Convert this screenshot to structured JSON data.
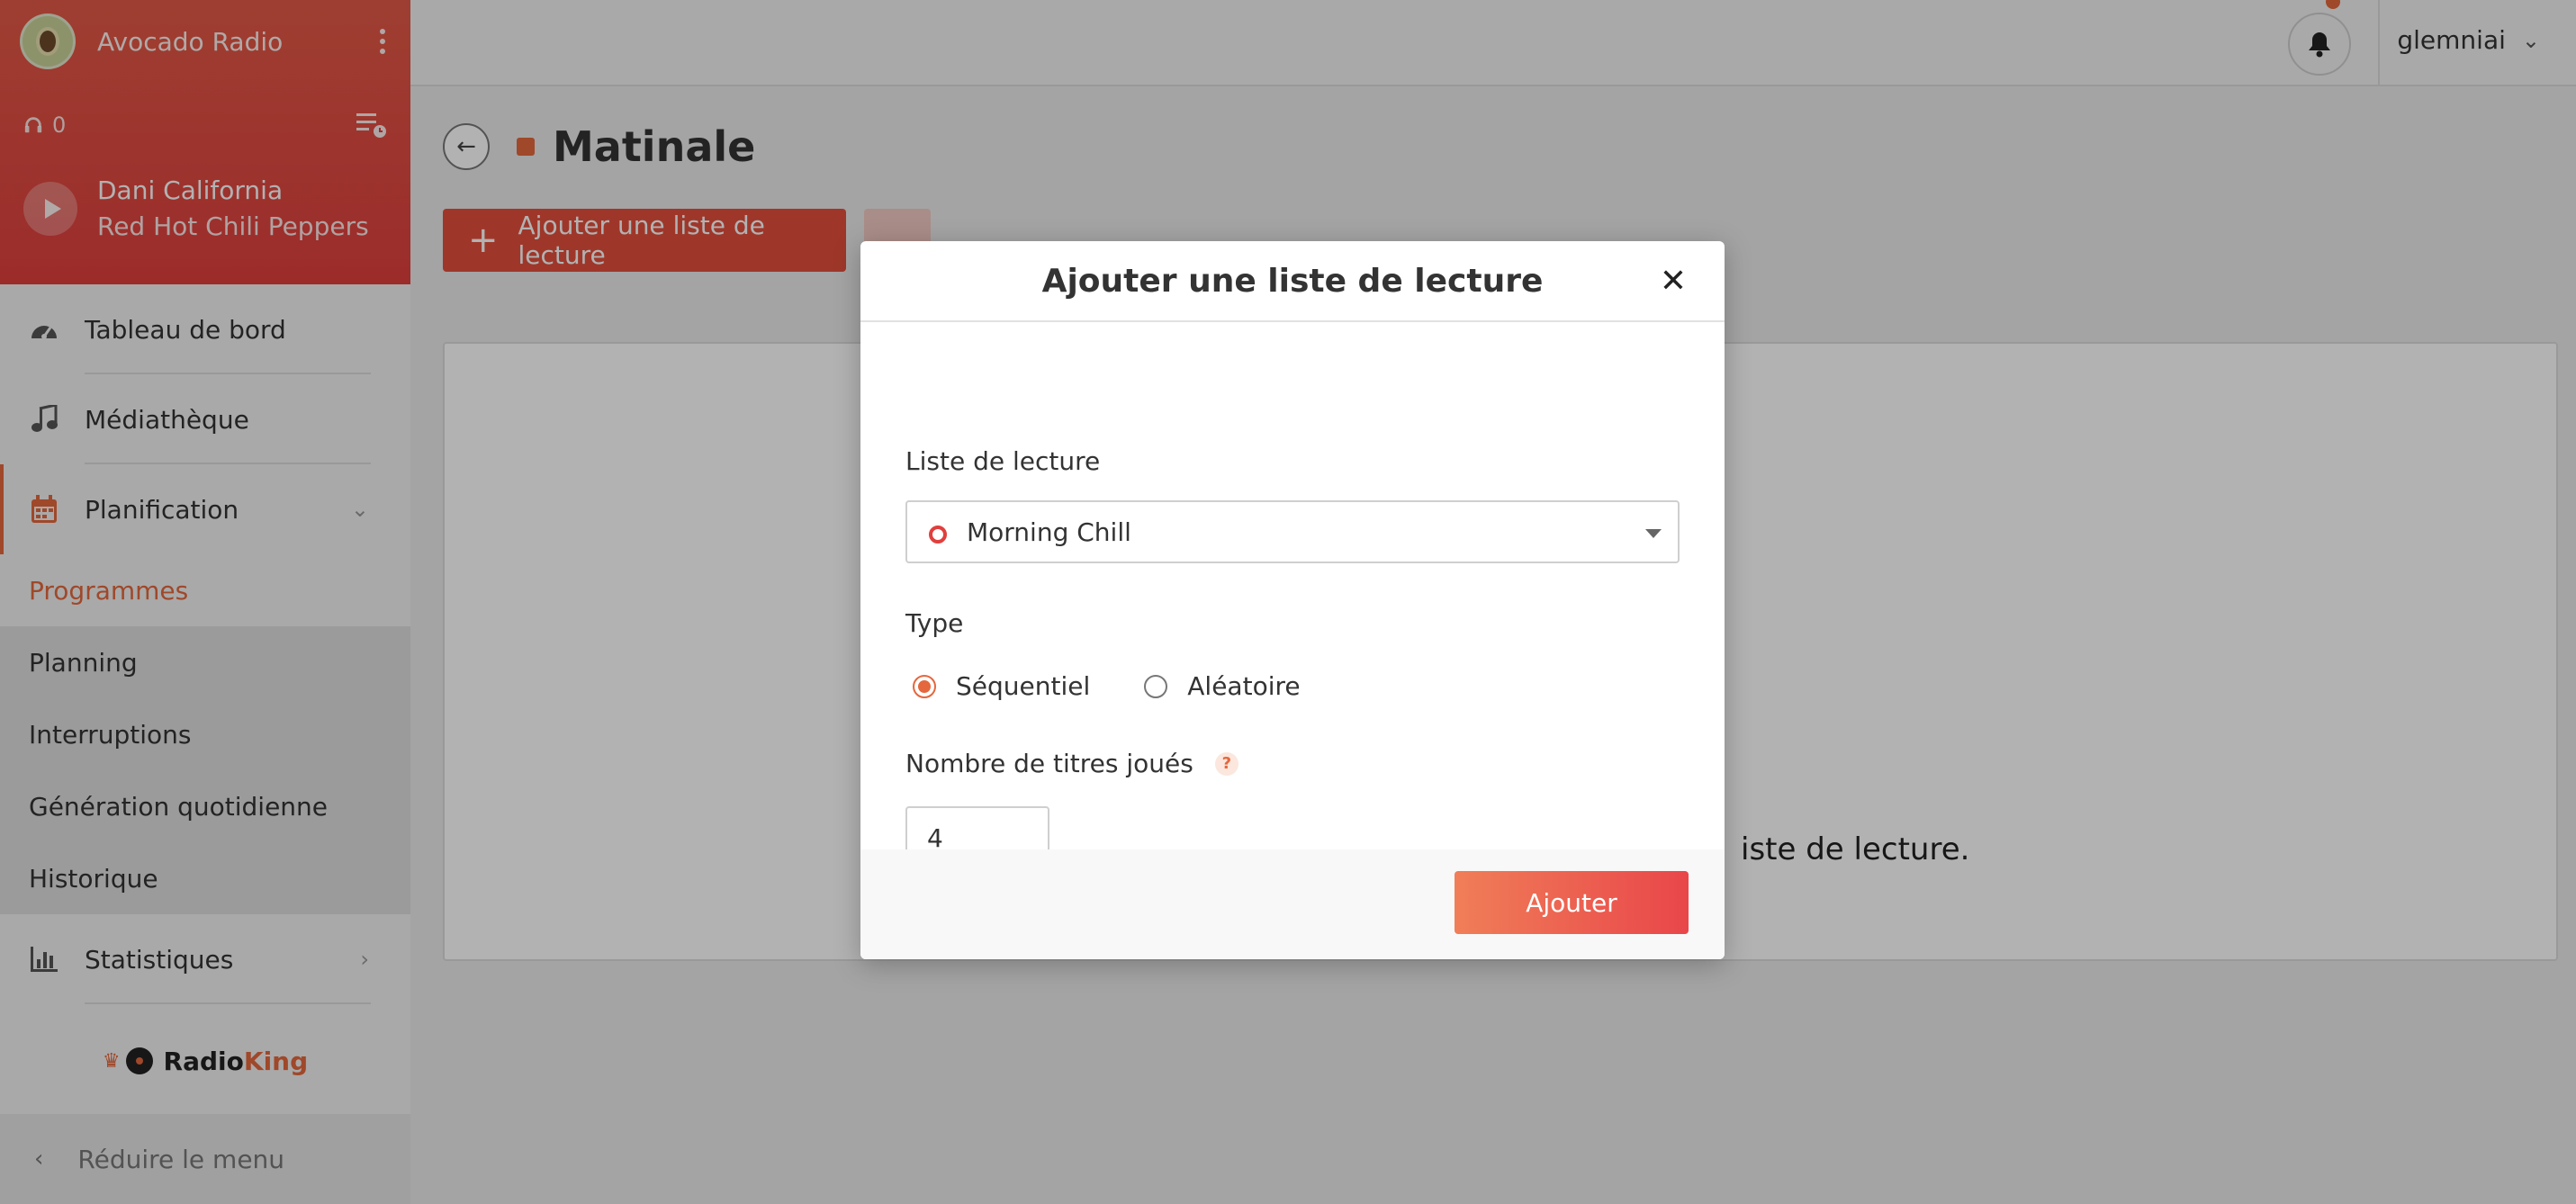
{
  "sidebar": {
    "station_name": "Avocado Radio",
    "listeners": "0",
    "now_playing": {
      "title": "Dani California",
      "artist": "Red Hot Chili Peppers"
    },
    "nav": [
      {
        "label": "Tableau de bord",
        "icon": "gauge-icon"
      },
      {
        "label": "Médiathèque",
        "icon": "music-note-icon"
      },
      {
        "label": "Planification",
        "icon": "calendar-icon"
      }
    ],
    "sub_nav": [
      "Programmes",
      "Planning",
      "Interruptions",
      "Génération quotidienne",
      "Historique"
    ],
    "stats_label": "Statistiques",
    "brand": {
      "part1": "Radio",
      "part2": "King"
    },
    "collapse_label": "Réduire le menu"
  },
  "topbar": {
    "username": "glemniai"
  },
  "content": {
    "page_title": "Matinale",
    "add_button": "Ajouter une liste de lecture",
    "more_button": "...",
    "empty_message": "iste de lecture."
  },
  "modal": {
    "title": "Ajouter une liste de lecture",
    "playlist_label": "Liste de lecture",
    "playlist_value": "Morning Chill",
    "type_label": "Type",
    "type_options": [
      "Séquentiel",
      "Aléatoire"
    ],
    "type_selected": "Séquentiel",
    "count_label": "Nombre de titres joués",
    "count_value": "4",
    "help_symbol": "?",
    "submit_label": "Ajouter"
  },
  "colors": {
    "accent": "#e4673d",
    "header_red": "#e03f3d"
  }
}
